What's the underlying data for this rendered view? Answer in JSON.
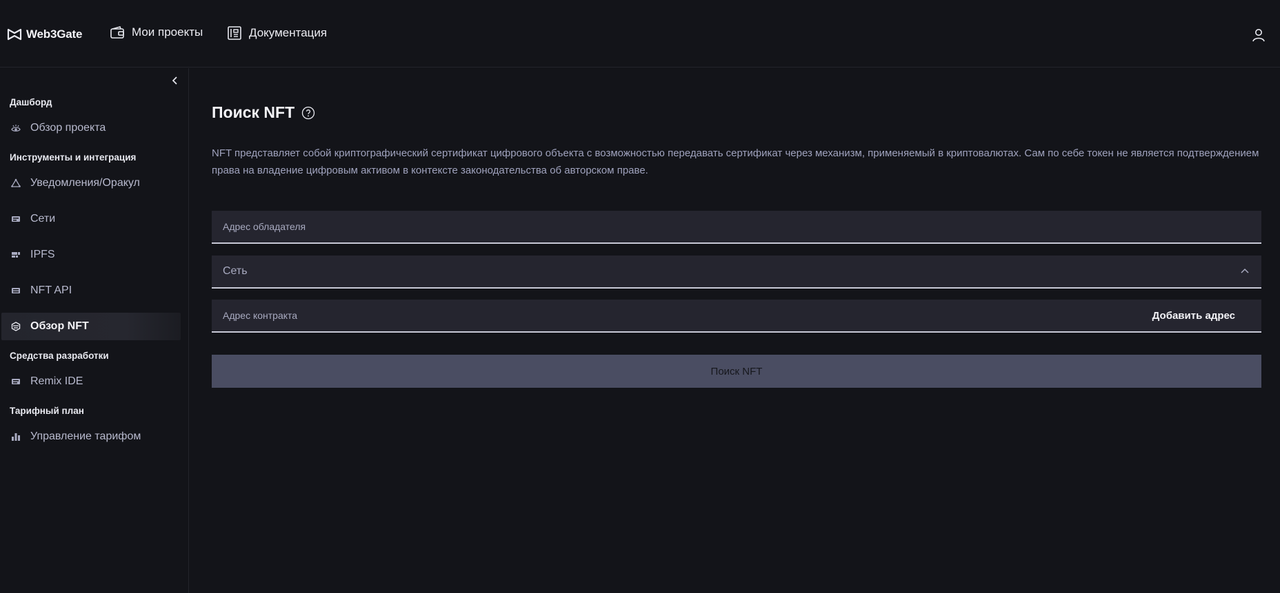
{
  "header": {
    "logo_text": "Web3Gate",
    "nav": [
      {
        "label": "Мои проекты",
        "icon": "wallet-icon"
      },
      {
        "label": "Документация",
        "icon": "document-icon"
      }
    ],
    "user_icon": "user-icon"
  },
  "sidebar": {
    "sections": [
      {
        "title": "Дашборд",
        "items": [
          {
            "label": "Обзор проекта",
            "icon": "eye-icon"
          }
        ]
      },
      {
        "title": "Инструменты и интеграция",
        "items": [
          {
            "label": "Уведомления/Оракул",
            "icon": "triangle-icon"
          },
          {
            "label": "Сети",
            "icon": "network-icon"
          },
          {
            "label": "IPFS",
            "icon": "ipfs-icon"
          },
          {
            "label": "NFT API",
            "icon": "api-icon"
          },
          {
            "label": "Обзор NFT",
            "icon": "nft-icon",
            "active": true
          }
        ]
      },
      {
        "title": "Средства разработки",
        "items": [
          {
            "label": "Remix IDE",
            "icon": "ide-icon"
          }
        ]
      },
      {
        "title": "Тарифный план",
        "items": [
          {
            "label": "Управление тарифом",
            "icon": "chart-icon"
          }
        ]
      }
    ]
  },
  "main": {
    "title": "Поиск NFT",
    "description": "NFT представляет собой криптографический сертификат цифрового объекта с возможностью передавать сертификат через механизм, применяемый в криптовалютах. Сам по себе токен не является подтверждением права на владение цифровым активом в контексте законодательства об авторском праве.",
    "form": {
      "owner_placeholder": "Адрес обладателя",
      "network_label": "Сеть",
      "contract_placeholder": "Адрес контракта",
      "add_address_label": "Добавить адрес",
      "submit_label": "Поиск NFT"
    }
  },
  "colors": {
    "background": "#131419",
    "field_bg": "#25252f",
    "button_bg": "#4a4d62",
    "muted_text": "#9fa2bd"
  }
}
